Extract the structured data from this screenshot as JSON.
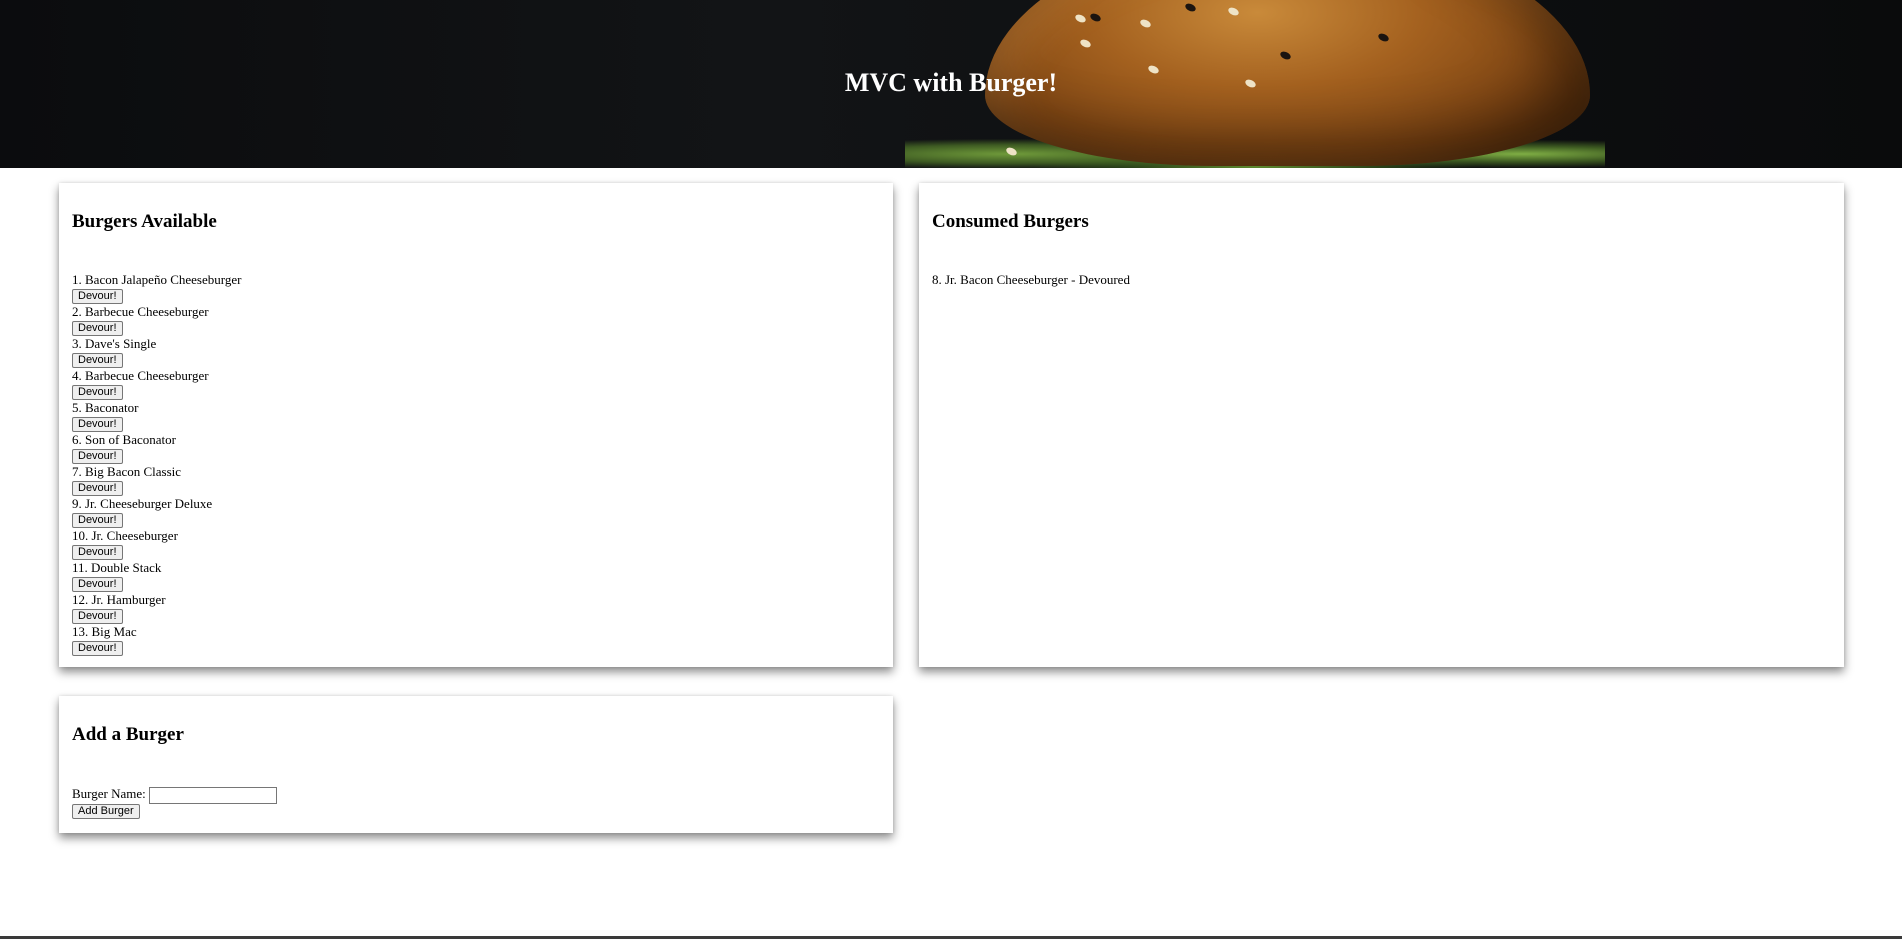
{
  "hero": {
    "title": "MVC with Burger!"
  },
  "available": {
    "heading": "Burgers Available",
    "button_label": "Devour!",
    "items": [
      "1. Bacon Jalapeño Cheeseburger",
      "2. Barbecue Cheeseburger",
      "3. Dave's Single",
      "4. Barbecue Cheeseburger",
      "5. Baconator",
      "6. Son of Baconator",
      "7. Big Bacon Classic",
      "9. Jr. Cheeseburger Deluxe",
      "10. Jr. Cheeseburger",
      "11. Double Stack",
      "12. Jr. Hamburger",
      "13. Big Mac"
    ]
  },
  "consumed": {
    "heading": "Consumed Burgers",
    "items": [
      "8. Jr. Bacon Cheeseburger - Devoured"
    ]
  },
  "add_form": {
    "heading": "Add a Burger",
    "label": "Burger Name:",
    "input_value": "",
    "submit_label": "Add Burger"
  }
}
